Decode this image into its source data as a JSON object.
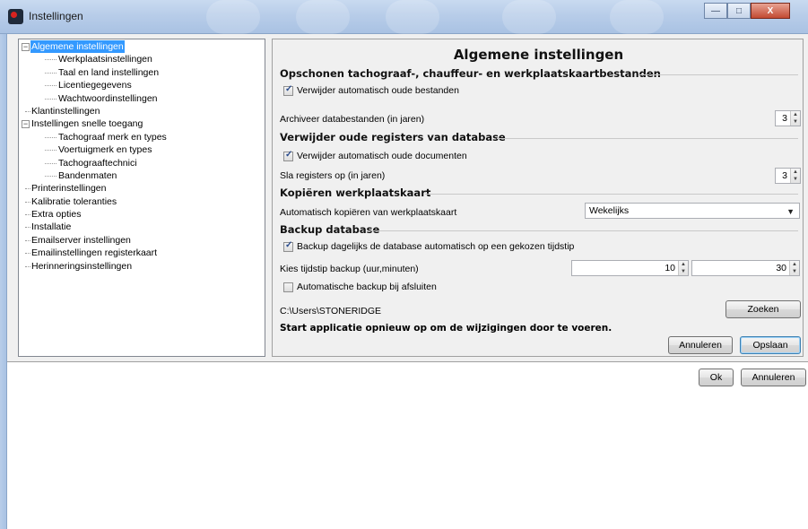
{
  "window": {
    "title": "Instellingen",
    "app_icon": "C"
  },
  "window_controls": {
    "minimize": "—",
    "maximize": "□",
    "close": "X"
  },
  "tree": [
    {
      "label": "Algemene instellingen",
      "level": 0,
      "expander": "−",
      "selected": true
    },
    {
      "label": "Werkplaatsinstellingen",
      "level": 1
    },
    {
      "label": "Taal en land instellingen",
      "level": 1
    },
    {
      "label": "Licentiegegevens",
      "level": 1
    },
    {
      "label": "Wachtwoordinstellingen",
      "level": 1
    },
    {
      "label": "Klantinstellingen",
      "level": 0
    },
    {
      "label": "Instellingen snelle toegang",
      "level": 0,
      "expander": "−"
    },
    {
      "label": "Tachograaf merk en types",
      "level": 1
    },
    {
      "label": "Voertuigmerk en types",
      "level": 1
    },
    {
      "label": "Tachograaftechnici",
      "level": 1
    },
    {
      "label": "Bandenmaten",
      "level": 1
    },
    {
      "label": "Printerinstellingen",
      "level": 0
    },
    {
      "label": "Kalibratie toleranties",
      "level": 0
    },
    {
      "label": "Extra opties",
      "level": 0
    },
    {
      "label": "Installatie",
      "level": 0
    },
    {
      "label": "Emailserver instellingen",
      "level": 0
    },
    {
      "label": "Emailinstellingen registerkaart",
      "level": 0
    },
    {
      "label": "Herinneringsinstellingen",
      "level": 0
    }
  ],
  "panel": {
    "title": "Algemene instellingen",
    "section1": {
      "heading": "Opschonen tachograaf-, chauffeur- en werkplaatskaartbestanden",
      "checkbox_label": "Verwijder automatisch oude bestanden",
      "checked": true,
      "archive_label": "Archiveer databestanden (in jaren)",
      "archive_value": "3"
    },
    "section2": {
      "heading": "Verwijder oude registers van database",
      "checkbox_label": "Verwijder automatisch oude documenten",
      "checked": true,
      "keep_label": "Sla registers op (in jaren)",
      "keep_value": "3"
    },
    "section3": {
      "heading": "Kopiëren werkplaatskaart",
      "copy_label": "Automatisch kopiëren van werkplaatskaart",
      "copy_value": "Wekelijks"
    },
    "section4": {
      "heading": "Backup database",
      "checkbox_label": "Backup dagelijks de database automatisch op een gekozen tijdstip",
      "checked": true,
      "time_label": "Kies tijdstip backup (uur,minuten)",
      "hour_value": "10",
      "minute_value": "30",
      "exit_label": "Automatische backup bij afsluiten",
      "exit_checked": false,
      "path": "C:\\Users\\STONERIDGE",
      "search_button": "Zoeken"
    },
    "restart_note": "Start applicatie opnieuw op om de wijzigingen door te voeren.",
    "cancel_button": "Annuleren",
    "save_button": "Opslaan"
  },
  "dialog": {
    "ok_button": "Ok",
    "cancel_button": "Annuleren"
  }
}
